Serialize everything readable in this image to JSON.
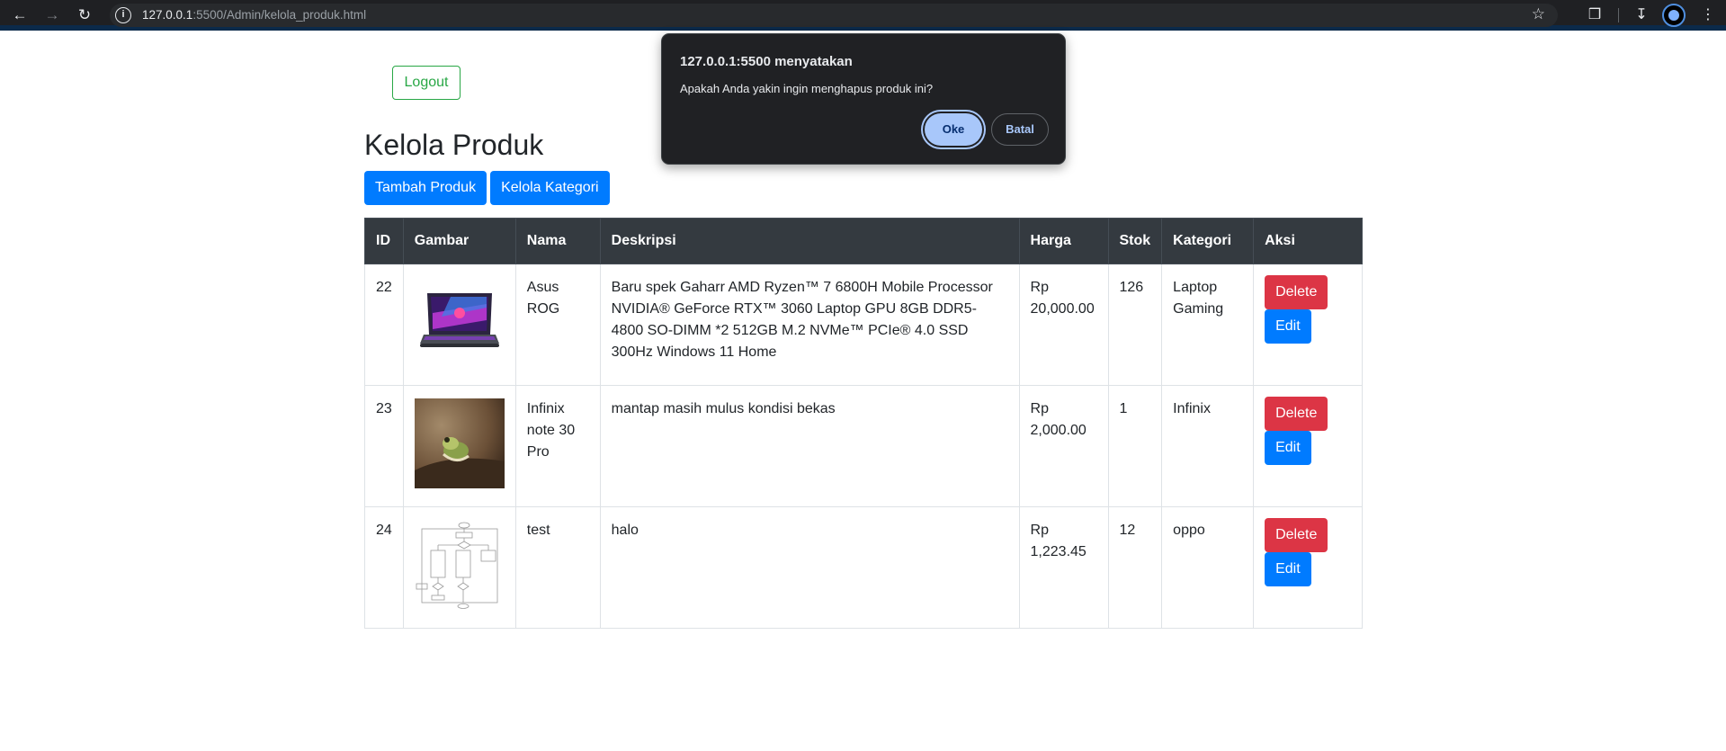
{
  "browser": {
    "url_host": "127.0.0.1",
    "url_rest": ":5500/Admin/kelola_produk.html"
  },
  "header": {
    "logout_label": "Logout",
    "title": "Kelola Produk",
    "add_product_label": "Tambah Produk",
    "manage_category_label": "Kelola Kategori"
  },
  "table": {
    "columns": [
      "ID",
      "Gambar",
      "Nama",
      "Deskripsi",
      "Harga",
      "Stok",
      "Kategori",
      "Aksi"
    ],
    "rows": [
      {
        "id": "22",
        "nama": "Asus ROG",
        "deskripsi": "Baru spek Gaharr AMD Ryzen™ 7 6800H Mobile Processor NVIDIA® GeForce RTX™ 3060 Laptop GPU 8GB DDR5-4800 SO-DIMM *2 512GB M.2 NVMe™ PCIe® 4.0 SSD 300Hz Windows 11 Home",
        "harga": "Rp 20,000.00",
        "stok": "126",
        "kategori": "Laptop Gaming",
        "image": "laptop-image"
      },
      {
        "id": "23",
        "nama": "Infinix note 30 Pro",
        "deskripsi": "mantap masih mulus kondisi bekas",
        "harga": "Rp 2,000.00",
        "stok": "1",
        "kategori": "Infinix",
        "image": "frog-photo-image"
      },
      {
        "id": "24",
        "nama": "test",
        "deskripsi": "halo",
        "harga": "Rp 1,223.45",
        "stok": "12",
        "kategori": "oppo",
        "image": "flowchart-image"
      }
    ],
    "delete_label": "Delete",
    "edit_label": "Edit"
  },
  "dialog": {
    "title": "127.0.0.1:5500 menyatakan",
    "message": "Apakah Anda yakin ingin menghapus produk ini?",
    "ok_label": "Oke",
    "cancel_label": "Batal"
  },
  "colors": {
    "primary": "#007bff",
    "danger": "#dc3545",
    "success": "#28a745",
    "table_header": "#343a40",
    "dialog_bg": "#202124",
    "dialog_accent": "#a8c7fa"
  }
}
